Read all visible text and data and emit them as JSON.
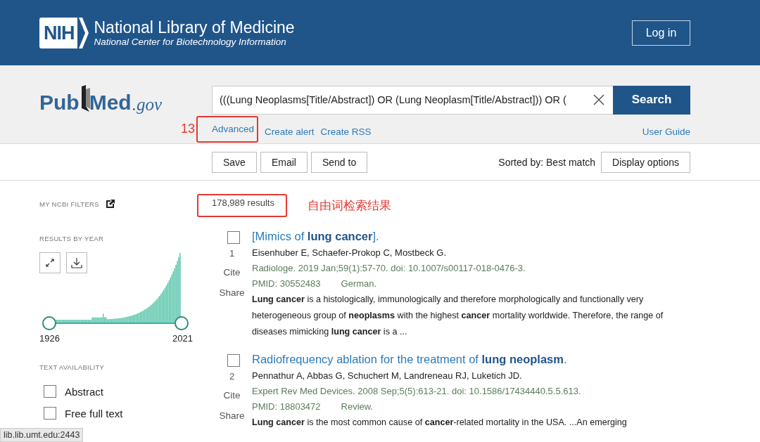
{
  "header": {
    "logo_mark": "NIH",
    "title": "National Library of Medicine",
    "subtitle": "National Center for Biotechnology Information",
    "login": "Log in"
  },
  "search": {
    "logo_pub": "Pub",
    "logo_med": "Med",
    "logo_gov": ".gov",
    "value": "(((Lung Neoplasms[Title/Abstract]) OR (Lung Neoplasm[Title/Abstract])) OR (",
    "button": "Search",
    "links": [
      "Advanced",
      "Create alert",
      "Create RSS"
    ],
    "guide": "User Guide",
    "annotation": "13"
  },
  "toolbar": {
    "buttons": [
      "Save",
      "Email",
      "Send to"
    ],
    "sort": "Sorted by: Best match",
    "display": "Display options"
  },
  "sidebar": {
    "filters": "MY NCBI FILTERS",
    "by_year": "RESULTS BY YEAR",
    "year_start": "1926",
    "year_end": "2021",
    "availability": "TEXT AVAILABILITY",
    "options": [
      {
        "label": "Abstract",
        "checked": false
      },
      {
        "label": "Free full text",
        "checked": false
      }
    ]
  },
  "results": {
    "count": "178,989 results",
    "annotation": "自由词检索结果",
    "items": [
      {
        "number": "1",
        "checked": false,
        "title": "[Mimics of **lung cancer**].",
        "authors": "Eisenhuber E, Schaefer-Prokop C, Mostbeck G.",
        "citation": "Radiologe. 2019 Jan;59(1):57-70. doi: 10.1007/s00117-018-0476-3.",
        "pmid": "PMID: 30552483",
        "note": "German.",
        "snippet": "**Lung cancer** is a histologically, immunologically and therefore morphologically and functionally very heterogeneous group of **neoplasms** with the highest **cancer** mortality worldwide. Therefore, the range of diseases mimicking **lung cancer** is a ...",
        "cite": "Cite",
        "share": "Share"
      },
      {
        "number": "2",
        "checked": false,
        "title": "Radiofrequency ablation for the treatment of **lung neoplasm**.",
        "authors": "Pennathur A, Abbas G, Schuchert M, Landreneau RJ, Luketich JD.",
        "citation": "Expert Rev Med Devices. 2008 Sep;5(5):613-21. doi: 10.1586/17434440.5.5.613.",
        "pmid": "PMID: 18803472",
        "note": "Review.",
        "snippet": "**Lung cancer** is the most common cause of **cancer**-related mortality in the USA. ...An emerging",
        "cite": "Cite",
        "share": "Share"
      }
    ]
  },
  "status_url": "lib.lib.umt.edu:2443"
}
